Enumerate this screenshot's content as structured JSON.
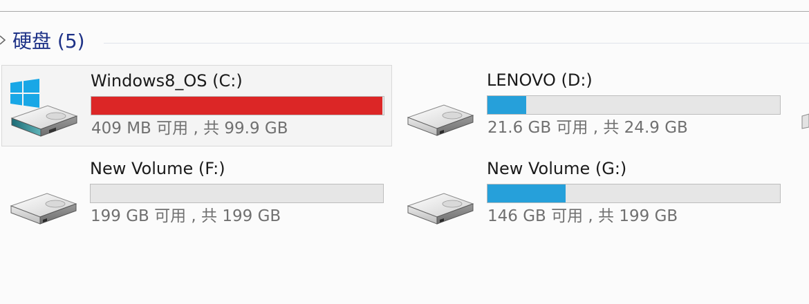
{
  "section": {
    "title": "硬盘 (5)"
  },
  "colors": {
    "critical_fill": "#dc2626",
    "normal_fill": "#26a0da",
    "bar_background": "#e6e6e6",
    "header_text": "#1e3287",
    "secondary_text": "#707070"
  },
  "drives": [
    {
      "name": "Windows8_OS (C:)",
      "space": "409 MB 可用 , 共 99.9 GB",
      "used_fraction": 0.996,
      "status": "critical",
      "icon": "windows-drive-icon",
      "selected": true
    },
    {
      "name": "LENOVO (D:)",
      "space": "21.6 GB 可用 , 共 24.9 GB",
      "used_fraction": 0.133,
      "status": "normal",
      "icon": "hard-drive-icon",
      "selected": false
    },
    {
      "name": "New Volume (F:)",
      "space": "199 GB 可用 , 共 199 GB",
      "used_fraction": 0.0,
      "status": "normal",
      "icon": "hard-drive-icon",
      "selected": false
    },
    {
      "name": "New Volume (G:)",
      "space": "146 GB 可用 , 共 199 GB",
      "used_fraction": 0.266,
      "status": "normal",
      "icon": "hard-drive-icon",
      "selected": false
    }
  ]
}
